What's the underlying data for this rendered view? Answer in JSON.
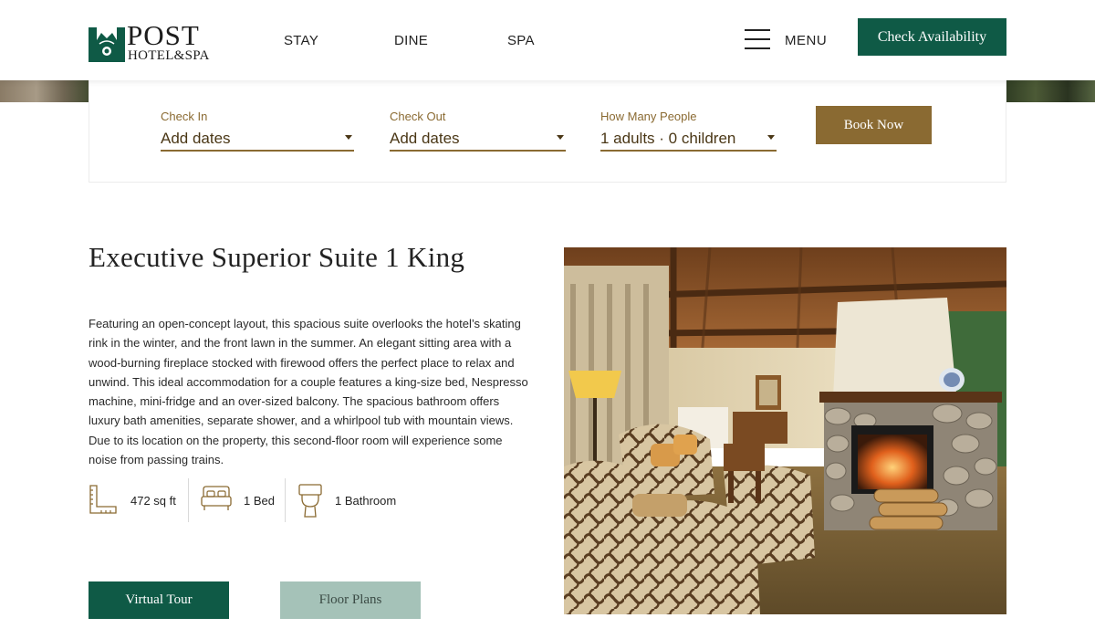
{
  "brand": {
    "name_line1": "POST",
    "name_line2": "HOTEL&SPA",
    "color": "#0f5a46"
  },
  "nav": {
    "links": [
      "STAY",
      "DINE",
      "SPA"
    ],
    "menu_label": "MENU",
    "cta_label": "Check Availability"
  },
  "booking": {
    "check_in": {
      "label": "Check In",
      "value": "Add dates"
    },
    "check_out": {
      "label": "Check Out",
      "value": "Add dates"
    },
    "people": {
      "label": "How Many People",
      "value": "1 adults · 0 children"
    },
    "book_label": "Book Now",
    "accent": "#8a6a32"
  },
  "room": {
    "title": "Executive Superior Suite 1 King",
    "description": "Featuring an open-concept layout, this spacious suite overlooks the hotel’s skating rink in the winter, and the front lawn in the summer. An elegant sitting area with a wood-burning fireplace stocked with firewood offers the perfect place to relax and unwind. This ideal accommodation for a couple features a king-size bed, Nespresso machine, mini-fridge and an over-sized balcony. The spacious bathroom offers luxury bath amenities, separate shower, and a whirlpool tub with mountain views. Due to its location on the property, this second-floor room will experience some noise from passing trains.",
    "amenities": [
      {
        "icon": "ruler-icon",
        "text": "472 sq ft"
      },
      {
        "icon": "bed-icon",
        "text": "1 Bed"
      },
      {
        "icon": "toilet-icon",
        "text": "1 Bathroom"
      }
    ],
    "buttons": {
      "virtual_tour": "Virtual Tour",
      "floor_plans": "Floor Plans"
    },
    "photo": {
      "icon": "room-photo"
    }
  }
}
